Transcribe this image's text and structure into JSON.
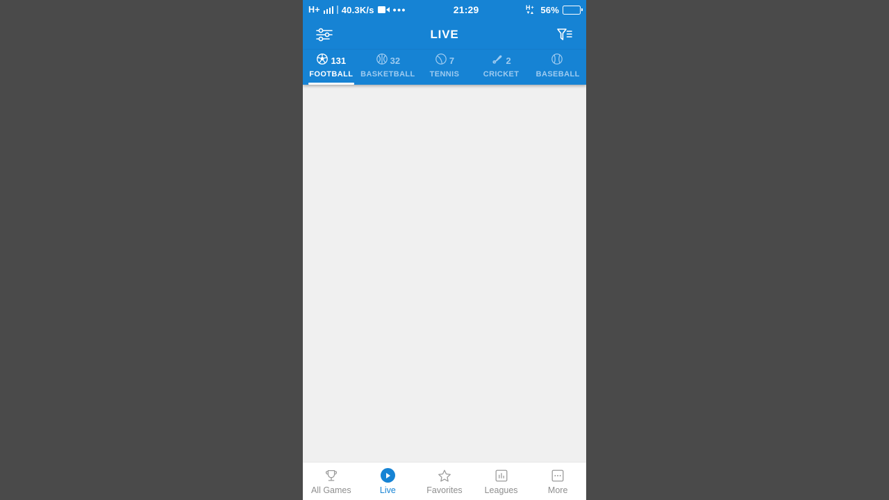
{
  "theme": {
    "header_blue": "#1683d4",
    "content_bg": "#f0f0f0",
    "nav_bg": "#ffffff",
    "inactive_tab": "#9ecbf0",
    "inactive_nav": "#8e8e8e"
  },
  "statusbar": {
    "network_type": "H+",
    "signal_icon": "signal-bars-icon",
    "data_speed": "40.3K/s",
    "screen_record_icon": "video-record-icon",
    "more_icon": "ellipsis-icon",
    "clock": "21:29",
    "hplus_data_icon": "hplus-data-icon",
    "battery_percent": "56%",
    "battery_icon": "battery-icon"
  },
  "header": {
    "settings_icon": "sliders-icon",
    "title": "LIVE",
    "filter_icon": "filter-icon"
  },
  "sport_tabs": [
    {
      "label": "FOOTBALL",
      "count": "131",
      "icon": "football-icon",
      "active": true
    },
    {
      "label": "BASKETBALL",
      "count": "32",
      "icon": "basketball-icon",
      "active": false
    },
    {
      "label": "TENNIS",
      "count": "7",
      "icon": "tennis-icon",
      "active": false
    },
    {
      "label": "CRICKET",
      "count": "2",
      "icon": "cricket-icon",
      "active": false
    },
    {
      "label": "BASEBALL",
      "count": "",
      "icon": "baseball-icon",
      "active": false
    }
  ],
  "content": {
    "empty": ""
  },
  "bottom_nav": [
    {
      "label": "All Games",
      "icon": "trophy-icon",
      "active": false
    },
    {
      "label": "Live",
      "icon": "play-icon",
      "active": true
    },
    {
      "label": "Favorites",
      "icon": "star-icon",
      "active": false
    },
    {
      "label": "Leagues",
      "icon": "barchart-icon",
      "active": false
    },
    {
      "label": "More",
      "icon": "more-icon",
      "active": false
    }
  ]
}
